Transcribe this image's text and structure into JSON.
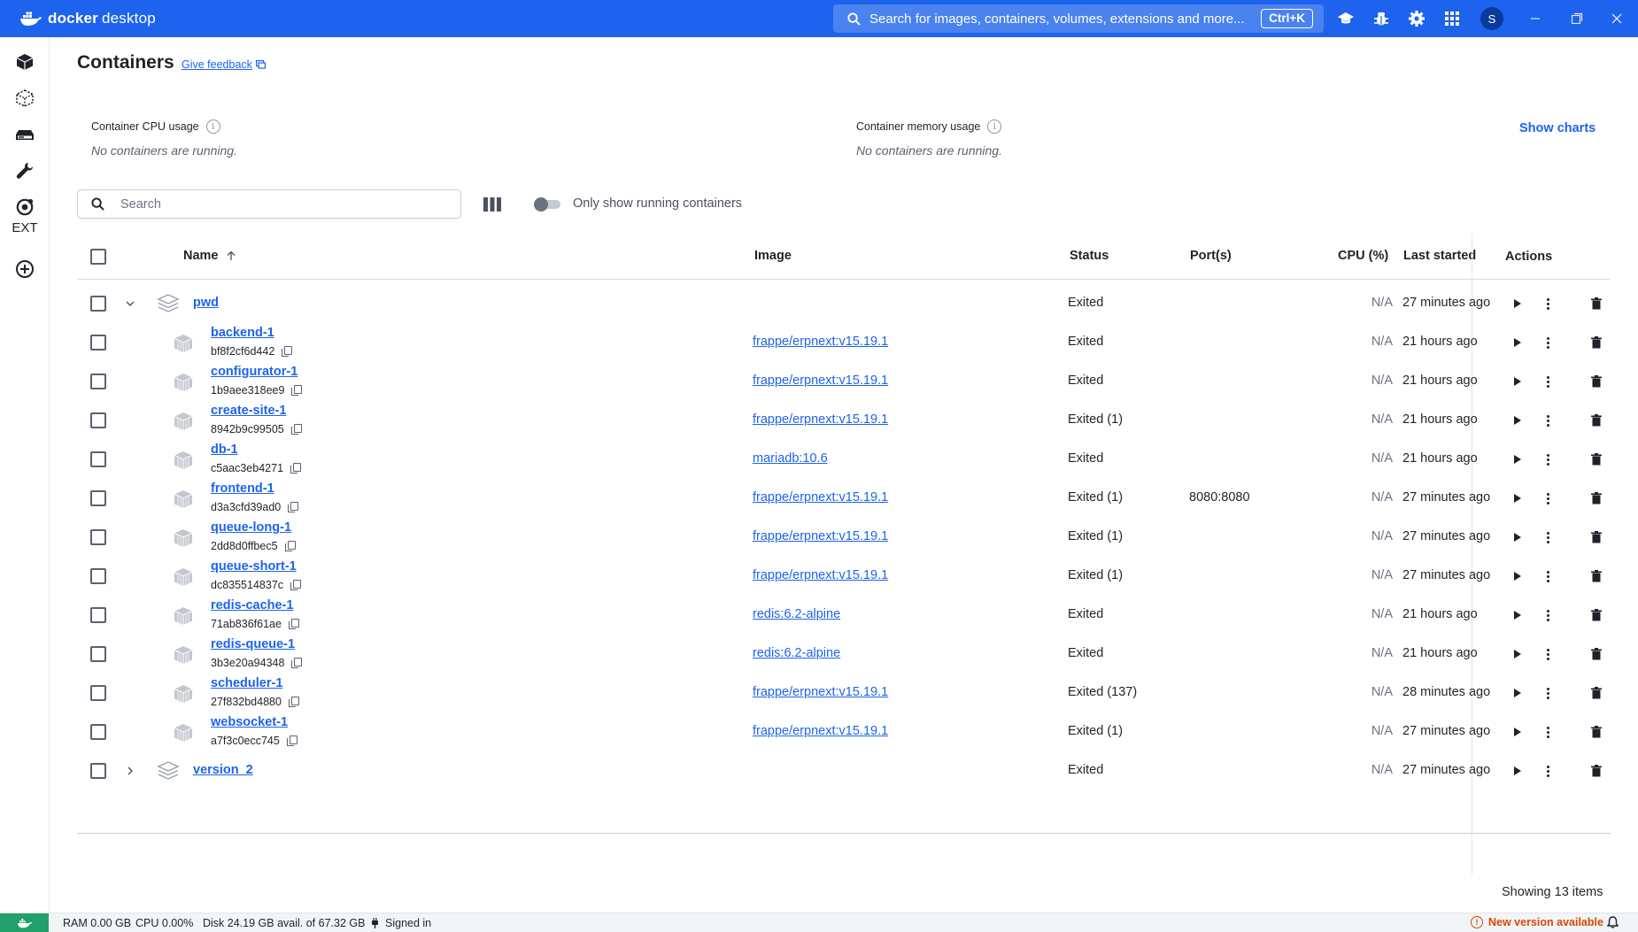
{
  "app": {
    "brand_bold": "docker",
    "brand_light": "desktop"
  },
  "titlebar": {
    "search_placeholder": "Search for images, containers, volumes, extensions and more...",
    "shortcut": "Ctrl+K",
    "avatar_initial": "S",
    "icons": [
      "learning-center-icon",
      "troubleshoot-bug-icon",
      "settings-gear-icon",
      "apps-grid-icon"
    ]
  },
  "sidebar": {
    "items": [
      "containers-icon",
      "images-icon",
      "volumes-icon",
      "dev-environments-icon",
      "docker-scout-icon"
    ],
    "ext_label": "EXT",
    "add_extension": "add-extension-icon"
  },
  "page": {
    "title": "Containers",
    "feedback_link": "Give feedback",
    "cpu_label": "Container CPU usage",
    "cpu_empty": "No containers are running.",
    "memory_label": "Container memory usage",
    "memory_empty": "No containers are running.",
    "show_charts": "Show charts",
    "search_placeholder": "Search",
    "toggle_label": "Only show running containers",
    "toggle_on": false
  },
  "table": {
    "headers": {
      "name": "Name",
      "image": "Image",
      "status": "Status",
      "ports": "Port(s)",
      "cpu": "CPU (%)",
      "last_started": "Last started",
      "actions": "Actions"
    },
    "groups": [
      {
        "name": "pwd",
        "expanded": true,
        "status": "Exited",
        "cpu": "N/A",
        "last_started": "27 minutes ago"
      },
      {
        "name": "version_2",
        "expanded": false,
        "status": "Exited",
        "cpu": "N/A",
        "last_started": "27 minutes ago"
      }
    ],
    "containers": [
      {
        "name": "backend-1",
        "id": "bf8f2cf6d442",
        "image": "frappe/erpnext:v15.19.1",
        "status": "Exited",
        "ports": "",
        "cpu": "N/A",
        "last_started": "21 hours ago"
      },
      {
        "name": "configurator-1",
        "id": "1b9aee318ee9",
        "image": "frappe/erpnext:v15.19.1",
        "status": "Exited",
        "ports": "",
        "cpu": "N/A",
        "last_started": "21 hours ago"
      },
      {
        "name": "create-site-1",
        "id": "8942b9c99505",
        "image": "frappe/erpnext:v15.19.1",
        "status": "Exited (1)",
        "ports": "",
        "cpu": "N/A",
        "last_started": "21 hours ago"
      },
      {
        "name": "db-1",
        "id": "c5aac3eb4271",
        "image": "mariadb:10.6",
        "status": "Exited",
        "ports": "",
        "cpu": "N/A",
        "last_started": "21 hours ago"
      },
      {
        "name": "frontend-1",
        "id": "d3a3cfd39ad0",
        "image": "frappe/erpnext:v15.19.1",
        "status": "Exited (1)",
        "ports": "8080:8080",
        "cpu": "N/A",
        "last_started": "27 minutes ago"
      },
      {
        "name": "queue-long-1",
        "id": "2dd8d0ffbec5",
        "image": "frappe/erpnext:v15.19.1",
        "status": "Exited (1)",
        "ports": "",
        "cpu": "N/A",
        "last_started": "27 minutes ago"
      },
      {
        "name": "queue-short-1",
        "id": "dc835514837c",
        "image": "frappe/erpnext:v15.19.1",
        "status": "Exited (1)",
        "ports": "",
        "cpu": "N/A",
        "last_started": "27 minutes ago"
      },
      {
        "name": "redis-cache-1",
        "id": "71ab836f61ae",
        "image": "redis:6.2-alpine",
        "status": "Exited",
        "ports": "",
        "cpu": "N/A",
        "last_started": "21 hours ago"
      },
      {
        "name": "redis-queue-1",
        "id": "3b3e20a94348",
        "image": "redis:6.2-alpine",
        "status": "Exited",
        "ports": "",
        "cpu": "N/A",
        "last_started": "21 hours ago"
      },
      {
        "name": "scheduler-1",
        "id": "27f832bd4880",
        "image": "frappe/erpnext:v15.19.1",
        "status": "Exited (137)",
        "ports": "",
        "cpu": "N/A",
        "last_started": "28 minutes ago"
      },
      {
        "name": "websocket-1",
        "id": "a7f3c0ecc745",
        "image": "frappe/erpnext:v15.19.1",
        "status": "Exited (1)",
        "ports": "",
        "cpu": "N/A",
        "last_started": "27 minutes ago"
      }
    ],
    "showing": "Showing 13 items"
  },
  "statusbar": {
    "ram": "RAM 0.00 GB",
    "cpu": "CPU 0.00%",
    "disk": "Disk 24.19 GB avail. of 67.32 GB",
    "signed_in": "Signed in",
    "new_version": "New version available"
  },
  "colors": {
    "accent": "#1d63ed",
    "engine_running": "#22a06b",
    "warning": "#d14b00"
  }
}
